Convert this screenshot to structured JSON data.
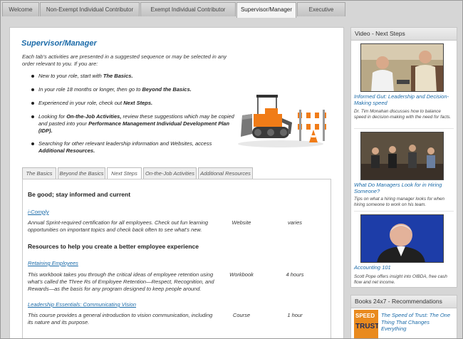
{
  "top_tabs": [
    {
      "label": "Welcome",
      "active": false
    },
    {
      "label": "Non-Exempt Individual Contributor",
      "active": false
    },
    {
      "label": "Exempt Individual Contributor",
      "active": false
    },
    {
      "label": "Supervisor/Manager",
      "active": true
    },
    {
      "label": "Executive",
      "active": false
    }
  ],
  "main": {
    "title": "Supervisor/Manager",
    "intro": "Each tab's activities are presented in a suggested sequence or may be selected in any order relevant to you. If you are:",
    "bullets": [
      {
        "pre": "New to your role, start with ",
        "bold": "The Basics.",
        "post": ""
      },
      {
        "pre": "In your role 18 months or longer, then go to ",
        "bold": "Beyond the Basics.",
        "post": ""
      },
      {
        "pre": "Experienced in your role, check out ",
        "bold": "Next Steps.",
        "post": ""
      },
      {
        "pre": "Looking for ",
        "bold": "On-the-Job Activities,",
        "post": " review these suggestions which may be copied and pasted into your ",
        "bold2": "Performance Management Individual Development Plan (IDP).",
        "post2": ""
      },
      {
        "pre": "Searching for other relevant leadership information and Websites, access ",
        "bold": "Additional Resources.",
        "post": ""
      }
    ],
    "inner_tabs": [
      {
        "label": "The Basics",
        "active": false
      },
      {
        "label": "Beyond the Basics",
        "active": false
      },
      {
        "label": "Next Steps",
        "active": true
      },
      {
        "label": "On-the-Job Activities",
        "active": false
      },
      {
        "label": "Additional Resources",
        "active": false
      }
    ],
    "sections": [
      {
        "heading": "Be good; stay informed and current"
      },
      {
        "heading": "Resources to help you create a better employee experience"
      }
    ],
    "resources": [
      {
        "title": "i-Comply",
        "description": "Annual Sprint-required certification for all employees.  Check out fun learning opportunities on important topics and check back often to see what's new.",
        "type": "Website",
        "time": "varies"
      },
      {
        "title": "Retaining Employees",
        "description": "This workbook takes you through the critical ideas of employee retention using what's called the Three Rs of Employee Retention—Respect, Recognition, and Rewards—as the basis for any program designed to keep people around.",
        "type": "Workbook",
        "time": "4 hours"
      },
      {
        "title": "Leadership Essentials: Communicating Vision",
        "description": "This course provides a general introduction to vision communication, including its nature and its purpose.",
        "type": "Course",
        "time": "1 hour"
      }
    ]
  },
  "sidebar": {
    "video_heading": "Video - Next Steps",
    "videos": [
      {
        "title": "Informed Gut: Leadership and Decision-Making speed",
        "description": "Dr. Tim Monahan discusses how to balance speed in decision-making with the need for facts."
      },
      {
        "title": "What Do Managers Look for in Hiring Someone?",
        "description": "Tips on what a hiring manager looks for when hiring someone to work on his team."
      },
      {
        "title": "Accounting 101",
        "description": "Scott Pope offers insight into OIBDA, free cash flow and net income."
      }
    ],
    "books_heading": "Books 24x7 - Recommendations",
    "books": [
      {
        "title": "The Speed of Trust: The One Thing That Changes Everything",
        "cover_text_1": "SPEED",
        "cover_text_2": "TRUST"
      }
    ]
  }
}
